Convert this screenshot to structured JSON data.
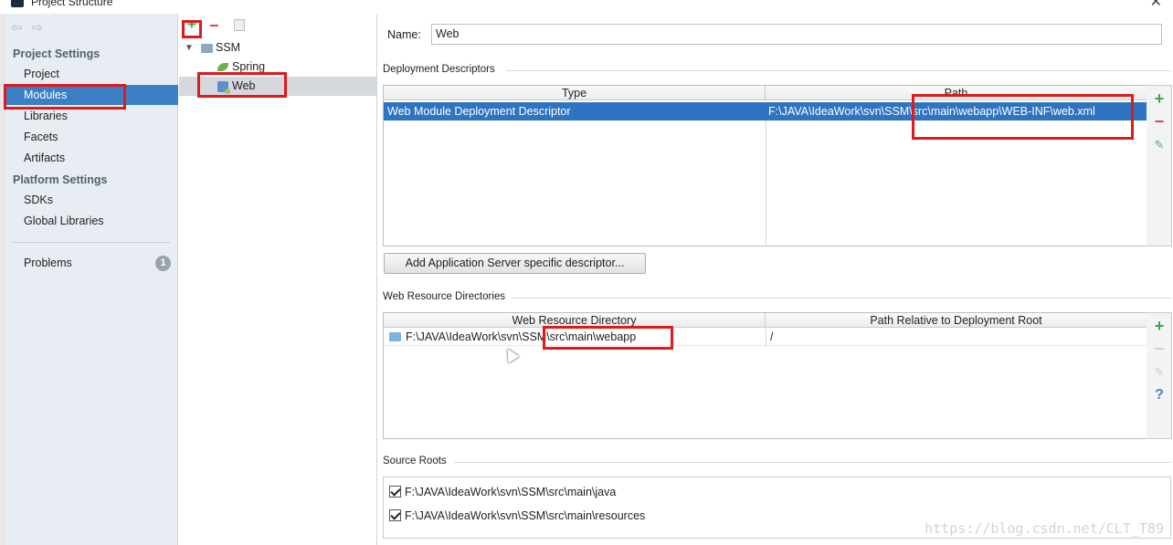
{
  "window": {
    "title": "Project Structure",
    "close_glyph": "✕"
  },
  "nav": {
    "back_glyph": "⇦",
    "forward_glyph": "⇨"
  },
  "sidebar": {
    "project_settings_header": "Project Settings",
    "project_items": [
      "Project",
      "Modules",
      "Libraries",
      "Facets",
      "Artifacts"
    ],
    "platform_settings_header": "Platform Settings",
    "platform_items": [
      "SDKs",
      "Global Libraries"
    ],
    "problems_label": "Problems",
    "problems_count": "1",
    "selected": "Modules"
  },
  "tree": {
    "toolbar": {
      "add_glyph": "+",
      "remove_glyph": "−"
    },
    "root": "SSM",
    "children": [
      "Spring",
      "Web"
    ],
    "selected": "Web"
  },
  "main": {
    "name_label": "Name:",
    "name_value": "Web",
    "deployment": {
      "title": "Deployment Descriptors",
      "columns": [
        "Type",
        "Path"
      ],
      "rows": [
        {
          "type": "Web Module Deployment Descriptor",
          "path": "F:\\JAVA\\IdeaWork\\svn\\SSM\\src\\main\\webapp\\WEB-INF\\web.xml"
        }
      ],
      "tools": {
        "add": "+",
        "remove": "−",
        "edit": "✎"
      },
      "button_label": "Add Application Server specific descriptor..."
    },
    "web_resources": {
      "title": "Web Resource Directories",
      "columns": [
        "Web Resource Directory",
        "Path Relative to Deployment Root"
      ],
      "rows": [
        {
          "directory": "F:\\JAVA\\IdeaWork\\svn\\SSM\\src\\main\\webapp",
          "relative": "/"
        }
      ],
      "tools": {
        "add": "+",
        "remove": "−",
        "edit": "✎",
        "help": "?"
      }
    },
    "source_roots": {
      "title": "Source Roots",
      "items": [
        {
          "path": "F:\\JAVA\\IdeaWork\\svn\\SSM\\src\\main\\java",
          "checked": true
        },
        {
          "path": "F:\\JAVA\\IdeaWork\\svn\\SSM\\src\\main\\resources",
          "checked": true
        }
      ]
    }
  },
  "watermark": "https://blog.csdn.net/CLT_T89",
  "colors": {
    "selection": "#3b80c4",
    "table_selection": "#2f74c0",
    "highlight_box": "#e0191b",
    "add": "#3aa845",
    "remove": "#d44a3a"
  }
}
